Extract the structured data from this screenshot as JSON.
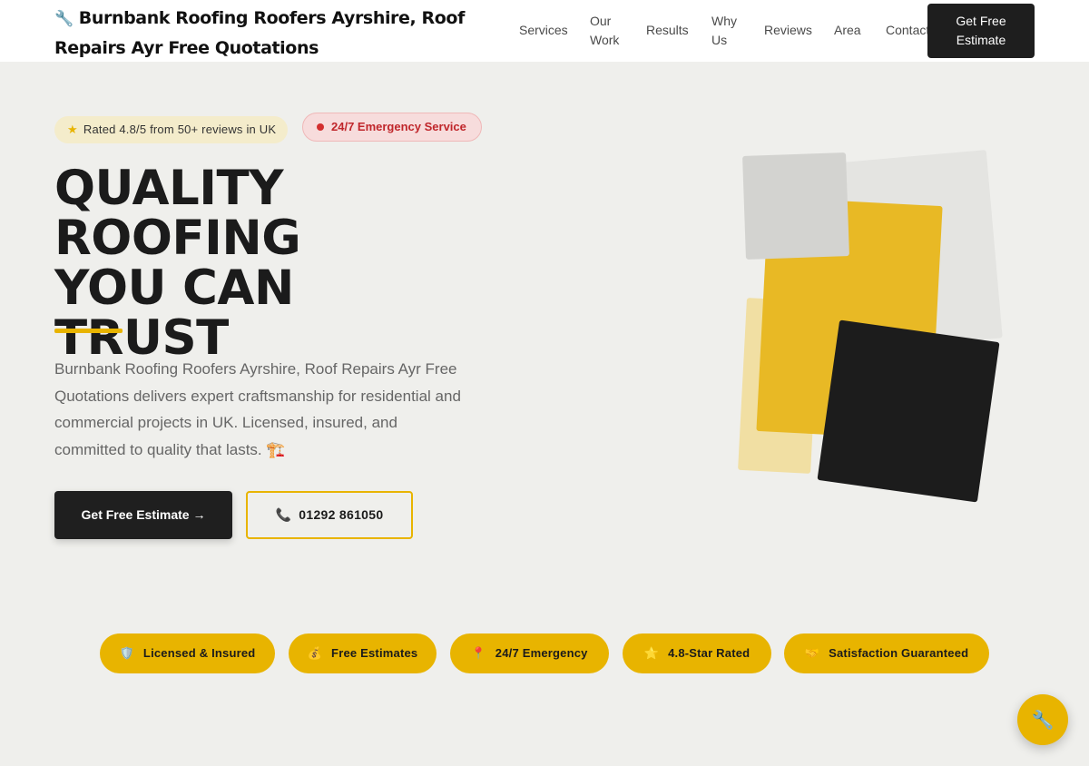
{
  "header": {
    "brand_icon": "wrench-icon",
    "brand_glyph": "🔧",
    "brand_title": "Burnbank Roofing Roofers Ayrshire, Roof Repairs Ayr Free Quotations",
    "nav": {
      "services": "Services",
      "our_work": "Our Work",
      "results": "Results",
      "why_us": "Why Us",
      "reviews": "Reviews",
      "area": "Area",
      "contact": "Contact"
    },
    "cta_label": "Get Free Estimate"
  },
  "hero": {
    "rating_badge": "Rated 4.8/5 from 50+ reviews in UK",
    "rating_icon": "star-icon",
    "emergency_badge": "24/7 Emergency Service",
    "title_lines": [
      "QUALITY ROOFING",
      "YOU CAN",
      "TRUST"
    ],
    "description": "Burnbank Roofing Roofers Ayrshire, Roof Repairs Ayr Free Quotations delivers expert craftsmanship for residential and commercial projects in UK. Licensed, insured, and committed to quality that lasts. 🏗️",
    "primary_button": "Get Free Estimate →",
    "phone_button": "01292 861050",
    "phone_icon": "phone-icon"
  },
  "trust": [
    {
      "icon": "shield-icon",
      "glyph": "🛡️",
      "label": "Licensed & Insured"
    },
    {
      "icon": "money-bag-icon",
      "glyph": "💰",
      "label": "Free Estimates"
    },
    {
      "icon": "pin-icon",
      "glyph": "📍",
      "label": "24/7 Emergency"
    },
    {
      "icon": "star-icon",
      "glyph": "⭐",
      "label": "4.8-Star Rated"
    },
    {
      "icon": "handshake-icon",
      "glyph": "🤝",
      "label": "Satisfaction Guaranteed"
    }
  ],
  "fab": {
    "icon": "wrench-icon",
    "glyph": "🔧"
  },
  "colors": {
    "accent": "#e8b400",
    "dark": "#1f1f1f",
    "background": "#efefec",
    "emergency": "#c0262b"
  }
}
